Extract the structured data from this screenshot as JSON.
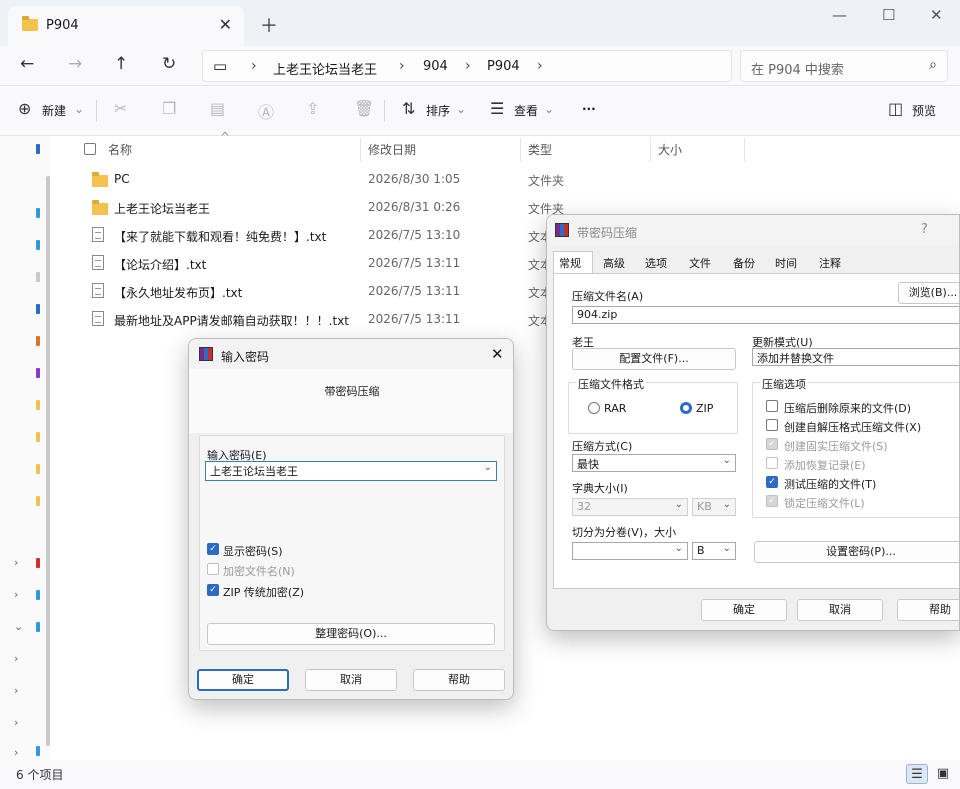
{
  "explorer": {
    "tab_title": "P904",
    "breadcrumbs": [
      "上老王论坛当老王",
      "904",
      "P904"
    ],
    "search_placeholder": "在 P904 中搜索",
    "toolbar": {
      "new_label": "新建",
      "sort_label": "排序",
      "view_label": "查看",
      "more_label": "···",
      "preview_label": "预览"
    },
    "columns": {
      "name": "名称",
      "date": "修改日期",
      "type": "类型",
      "size": "大小"
    },
    "files": [
      {
        "name": "PC",
        "date": "2026/8/30 1:05",
        "type": "文件夹",
        "kind": "folder"
      },
      {
        "name": "上老王论坛当老王",
        "date": "2026/8/31 0:26",
        "type": "文件夹",
        "kind": "folder"
      },
      {
        "name": "【来了就能下载和观看！纯免费！】.txt",
        "date": "2026/7/5 13:10",
        "type": "文本",
        "kind": "txt"
      },
      {
        "name": "【论坛介绍】.txt",
        "date": "2026/7/5 13:11",
        "type": "文本",
        "kind": "txt"
      },
      {
        "name": "【永久地址发布页】.txt",
        "date": "2026/7/5 13:11",
        "type": "文本",
        "kind": "txt"
      },
      {
        "name": "最新地址及APP请发邮箱自动获取！！！.txt",
        "date": "2026/7/5 13:11",
        "type": "文本",
        "kind": "txt"
      }
    ],
    "status": "6 个项目"
  },
  "archive_dialog": {
    "title": "带密码压缩",
    "help_char": "?",
    "tabs": [
      "常规",
      "高级",
      "选项",
      "文件",
      "备份",
      "时间",
      "注释"
    ],
    "archive_name_label": "压缩文件名(A)",
    "browse_button": "浏览(B)...",
    "archive_name_value": "904.zip",
    "profile_label": "老王",
    "profile_button": "配置文件(F)...",
    "update_mode_label": "更新模式(U)",
    "update_mode_value": "添加并替换文件",
    "format_group": "压缩文件格式",
    "format_rar": "RAR",
    "format_zip": "ZIP",
    "options_group": "压缩选项",
    "options": [
      {
        "label": "压缩后删除原来的文件(D)",
        "state": "off"
      },
      {
        "label": "创建自解压格式压缩文件(X)",
        "state": "off"
      },
      {
        "label": "创建固实压缩文件(S)",
        "state": "disabled"
      },
      {
        "label": "添加恢复记录(E)",
        "state": "disabled-off"
      },
      {
        "label": "测试压缩的文件(T)",
        "state": "on"
      },
      {
        "label": "锁定压缩文件(L)",
        "state": "disabled"
      }
    ],
    "method_label": "压缩方式(C)",
    "method_value": "最快",
    "dict_label": "字典大小(I)",
    "dict_value": "32",
    "dict_unit": "KB",
    "split_label": "切分为分卷(V)，大小",
    "split_unit": "B",
    "set_password_button": "设置密码(P)...",
    "ok_button": "确定",
    "cancel_button": "取消",
    "help_button": "帮助"
  },
  "password_dialog": {
    "title": "输入密码",
    "subtitle": "带密码压缩",
    "enter_label": "输入密码(E)",
    "password_value": "上老王论坛当老王",
    "show_password": "显示密码(S)",
    "encrypt_names": "加密文件名(N)",
    "zip_legacy": "ZIP 传统加密(Z)",
    "organize_button": "整理密码(O)...",
    "ok_button": "确定",
    "cancel_button": "取消",
    "help_button": "帮助"
  }
}
